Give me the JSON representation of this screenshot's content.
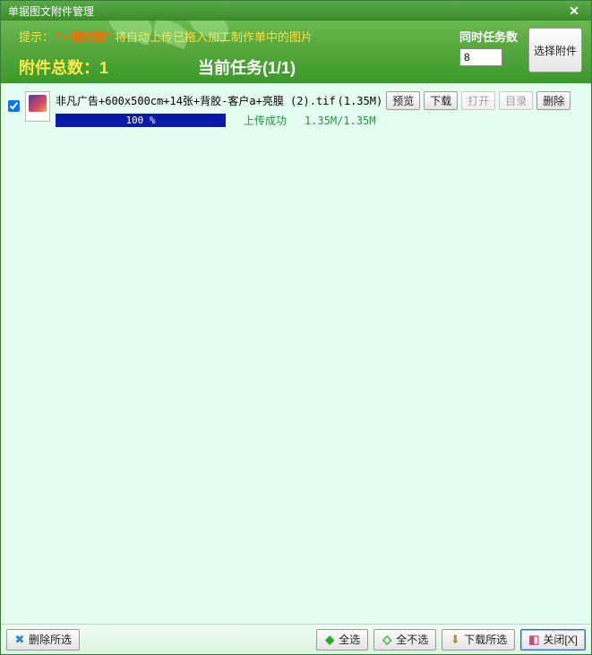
{
  "window": {
    "title": "单据图文附件管理"
  },
  "header": {
    "tip_prefix": "提示：",
    "tip_quoted": "\"一键传图\"",
    "tip_suffix": " 将自动上传已拖入加工制作单中的图片",
    "attach_count_label": "附件总数：",
    "attach_count_value": "1",
    "current_task_label": "当前任务",
    "current_task_progress": "(1/1)",
    "concurrent_label": "同时任务数",
    "concurrent_value": "8",
    "choose_button": "选择附件"
  },
  "item": {
    "filename": "非凡广告+600x500cm+14张+背胶-客户a+亮膜 (2).tif",
    "filesize": "(1.35M)",
    "btn_preview": "预览",
    "btn_download": "下载",
    "btn_open": "打开",
    "btn_dir": "目录",
    "btn_delete": "删除",
    "progress_pct": "100 %",
    "progress_fill_width": "100%",
    "status": "上传成功",
    "size_progress": "1.35M/1.35M",
    "checked": true
  },
  "footer": {
    "delete_selected": "删除所选",
    "select_all": "全选",
    "select_none": "全不选",
    "download_selected": "下载所选",
    "close": "关闭[X]"
  }
}
